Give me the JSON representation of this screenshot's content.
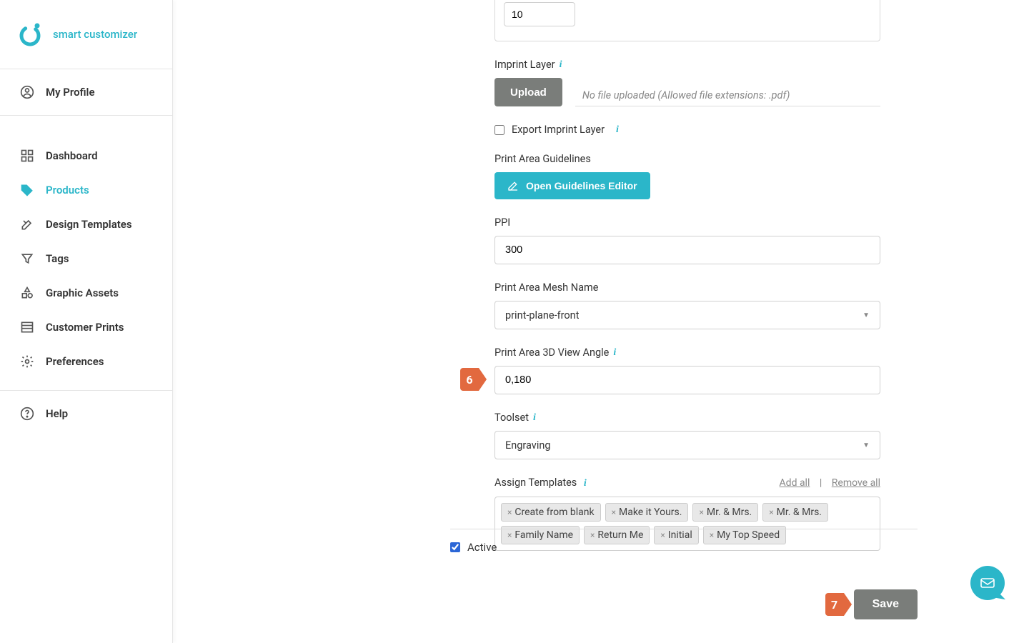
{
  "brand": {
    "name": "smart customizer"
  },
  "nav": {
    "profile": "My Profile",
    "items": [
      {
        "label": "Dashboard"
      },
      {
        "label": "Products"
      },
      {
        "label": "Design Templates"
      },
      {
        "label": "Tags"
      },
      {
        "label": "Graphic Assets"
      },
      {
        "label": "Customer Prints"
      },
      {
        "label": "Preferences"
      }
    ],
    "help": "Help"
  },
  "form": {
    "top_value": "10",
    "imprint_layer_label": "Imprint Layer",
    "upload_button": "Upload",
    "upload_hint": "No file uploaded (Allowed file extensions: .pdf)",
    "export_imprint_label": "Export Imprint Layer",
    "export_imprint_checked": false,
    "print_guidelines_label": "Print Area Guidelines",
    "guidelines_button": "Open Guidelines Editor",
    "ppi_label": "PPI",
    "ppi_value": "300",
    "mesh_label": "Print Area Mesh Name",
    "mesh_value": "print-plane-front",
    "view_angle_label": "Print Area 3D View Angle",
    "view_angle_value": "0,180",
    "toolset_label": "Toolset",
    "toolset_value": "Engraving",
    "templates_label": "Assign Templates",
    "add_all": "Add all",
    "remove_all": "Remove all",
    "templates": [
      "Create from blank",
      "Make it Yours.",
      "Mr. & Mrs.",
      "Mr. & Mrs.",
      "Family Name",
      "Return Me",
      "Initial",
      "My Top Speed"
    ],
    "active_label": "Active",
    "active_checked": true,
    "save_button": "Save"
  },
  "markers": {
    "m6": "6",
    "m7": "7"
  }
}
